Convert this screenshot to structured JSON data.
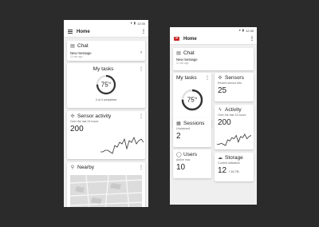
{
  "phone1": {
    "title": "Home",
    "status_time": "12:30",
    "chat": {
      "title": "Chat",
      "message": "New message",
      "time": "11 min ago"
    },
    "tasks": {
      "title": "My tasks",
      "percent": 75,
      "percent_label": "75",
      "percent_sign": "%",
      "caption": "3 of 4 completed"
    },
    "sensor": {
      "title": "Sensor activity",
      "subtitle": "Over the last 24 hours",
      "value": "200",
      "series": [
        6,
        6,
        7,
        7,
        6,
        5,
        10,
        9,
        12,
        11,
        14,
        8,
        13,
        12,
        15,
        11,
        13,
        14,
        12
      ]
    },
    "nearby": {
      "title": "Nearby"
    }
  },
  "phone2": {
    "title": "Home",
    "status_time": "12:30",
    "chat": {
      "title": "Chat",
      "message": "New message",
      "time": "11 min ago"
    },
    "tasks": {
      "title": "My tasks",
      "percent": 75,
      "percent_label": "75",
      "percent_sign": "%"
    },
    "sensors": {
      "title": "Sensors",
      "subtitle": "Recent sensor hits",
      "value": "25"
    },
    "activity": {
      "title": "Activity",
      "subtitle": "Over the last 24 hours",
      "value": "200",
      "series": [
        6,
        6,
        7,
        6,
        5,
        10,
        9,
        12,
        11,
        14,
        8,
        13,
        12,
        15,
        11,
        13,
        14
      ]
    },
    "sessions": {
      "title": "Sessions",
      "subtitle": "Unclaimed",
      "value": "2"
    },
    "users": {
      "title": "Users",
      "subtitle": "Active now",
      "value": "10"
    },
    "storage": {
      "title": "Storage",
      "subtitle": "Current utilization",
      "value": "12",
      "unit": "/ 16 TB"
    }
  },
  "colors": {
    "background": "#2b2b2b",
    "screen": "#efefef",
    "card": "#ffffff",
    "accent": "#c62828"
  },
  "icons": [
    "menu-icon",
    "more-vert-icon",
    "chat-icon",
    "chevron-right-icon",
    "sensor-icon",
    "location-pin-icon",
    "calendar-icon",
    "person-icon",
    "cloud-icon",
    "lightning-icon",
    "wifi-icon",
    "battery-icon"
  ]
}
